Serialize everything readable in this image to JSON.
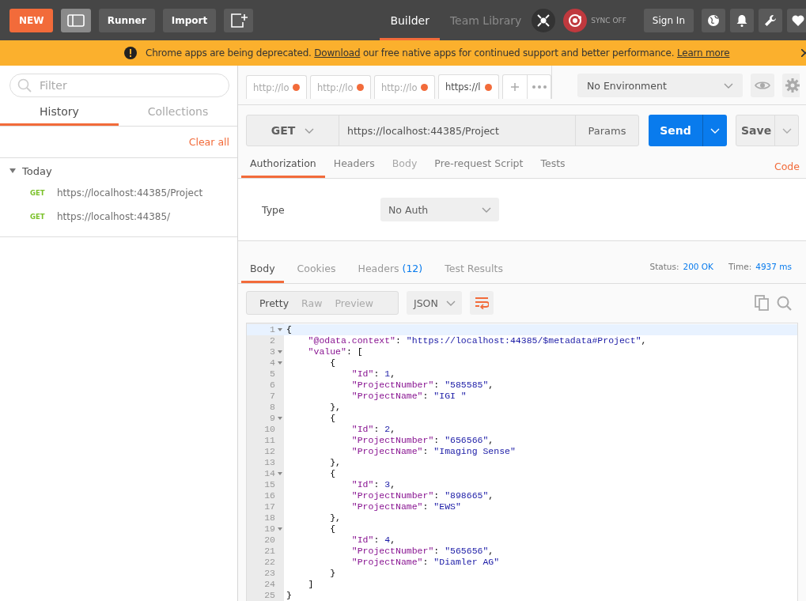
{
  "header": {
    "new_button": "NEW",
    "runner_button": "Runner",
    "import_button": "Import",
    "tabs": [
      {
        "label": "Builder",
        "selected": true
      },
      {
        "label": "Team Library",
        "selected": false
      }
    ],
    "sync": {
      "label": "SYNC OFF",
      "on": false
    },
    "sign_in_button": "Sign In"
  },
  "banner": {
    "text_before": "Chrome apps are being deprecated.",
    "link": "Download",
    "text_after": "our free native apps for continued support and better performance.",
    "learn_more": "Learn more"
  },
  "sidebar": {
    "filter": {
      "placeholder": "Filter"
    },
    "tabs": [
      {
        "label": "History",
        "selected": true
      },
      {
        "label": "Collections",
        "selected": false
      }
    ],
    "clear_all": "Clear all",
    "groups": [
      {
        "label": "Today",
        "expanded": true,
        "items": [
          {
            "method": "GET",
            "url": "https://localhost:44385/Project"
          },
          {
            "method": "GET",
            "url": "https://localhost:44385/"
          }
        ]
      }
    ]
  },
  "request_tabs": [
    {
      "label": "http://lo",
      "unsaved": true,
      "selected": false
    },
    {
      "label": "http://lo",
      "unsaved": true,
      "selected": false
    },
    {
      "label": "http://lo",
      "unsaved": true,
      "selected": false
    },
    {
      "label": "https://l",
      "unsaved": true,
      "selected": true
    }
  ],
  "environment": {
    "label": "No Environment"
  },
  "request": {
    "method": "GET",
    "url": "https://localhost:44385/Project",
    "params_button": "Params",
    "send_button": "Send",
    "save_button": "Save"
  },
  "request_sections": [
    {
      "label": "Authorization",
      "selected": true,
      "disabled": false
    },
    {
      "label": "Headers",
      "selected": false,
      "disabled": false
    },
    {
      "label": "Body",
      "selected": false,
      "disabled": true
    },
    {
      "label": "Pre-request Script",
      "selected": false,
      "disabled": false
    },
    {
      "label": "Tests",
      "selected": false,
      "disabled": false
    }
  ],
  "code_link": "Code",
  "auth": {
    "type_label": "Type",
    "type_value": "No Auth"
  },
  "response": {
    "tabs": [
      {
        "label": "Body",
        "selected": true
      },
      {
        "label": "Cookies",
        "selected": false
      },
      {
        "label": "Headers",
        "count": "(12)",
        "selected": false
      },
      {
        "label": "Test Results",
        "selected": false
      }
    ],
    "status_label": "Status:",
    "status_value": "200 OK",
    "time_label": "Time:",
    "time_value": "4937 ms",
    "view_modes": [
      {
        "label": "Pretty",
        "selected": true
      },
      {
        "label": "Raw",
        "selected": false
      },
      {
        "label": "Preview",
        "selected": false
      }
    ],
    "format": "JSON",
    "wrap_on": true,
    "lines": [
      {
        "number": "1",
        "active": true,
        "tokens": [
          {
            "kind": "punct",
            "text": "{"
          }
        ],
        "children": [
          {
            "number": "2",
            "active": false,
            "tokens": [
              {
                "kind": "key",
                "text": "\"@odata.context\""
              },
              {
                "kind": "punct",
                "text": ": "
              },
              {
                "kind": "string",
                "text": "\"https://localhost:44385/$metadata#Project\""
              },
              {
                "kind": "punct",
                "text": ","
              }
            ]
          },
          {
            "number": "3",
            "active": false,
            "tokens": [
              {
                "kind": "key",
                "text": "\"value\""
              },
              {
                "kind": "punct",
                "text": ": ["
              }
            ],
            "children": [
              {
                "number": "4",
                "active": false,
                "tokens": [
                  {
                    "kind": "punct",
                    "text": "{"
                  }
                ],
                "children": [
                  {
                    "number": "5",
                    "active": false,
                    "tokens": [
                      {
                        "kind": "key",
                        "text": "\"Id\""
                      },
                      {
                        "kind": "punct",
                        "text": ": "
                      },
                      {
                        "kind": "number",
                        "text": "1"
                      },
                      {
                        "kind": "punct",
                        "text": ","
                      }
                    ]
                  },
                  {
                    "number": "6",
                    "active": false,
                    "tokens": [
                      {
                        "kind": "key",
                        "text": "\"ProjectNumber\""
                      },
                      {
                        "kind": "punct",
                        "text": ": "
                      },
                      {
                        "kind": "string",
                        "text": "\"585585\""
                      },
                      {
                        "kind": "punct",
                        "text": ","
                      }
                    ]
                  },
                  {
                    "number": "7",
                    "active": false,
                    "tokens": [
                      {
                        "kind": "key",
                        "text": "\"ProjectName\""
                      },
                      {
                        "kind": "punct",
                        "text": ": "
                      },
                      {
                        "kind": "string",
                        "text": "\"IGI \""
                      }
                    ]
                  }
                ]
              },
              {
                "number": "8",
                "active": false,
                "tokens": [
                  {
                    "kind": "punct",
                    "text": "},"
                  }
                ]
              },
              {
                "number": "9",
                "active": false,
                "tokens": [
                  {
                    "kind": "punct",
                    "text": "{"
                  }
                ],
                "children": [
                  {
                    "number": "10",
                    "active": false,
                    "tokens": [
                      {
                        "kind": "key",
                        "text": "\"Id\""
                      },
                      {
                        "kind": "punct",
                        "text": ": "
                      },
                      {
                        "kind": "number",
                        "text": "2"
                      },
                      {
                        "kind": "punct",
                        "text": ","
                      }
                    ]
                  },
                  {
                    "number": "11",
                    "active": false,
                    "tokens": [
                      {
                        "kind": "key",
                        "text": "\"ProjectNumber\""
                      },
                      {
                        "kind": "punct",
                        "text": ": "
                      },
                      {
                        "kind": "string",
                        "text": "\"656566\""
                      },
                      {
                        "kind": "punct",
                        "text": ","
                      }
                    ]
                  },
                  {
                    "number": "12",
                    "active": false,
                    "tokens": [
                      {
                        "kind": "key",
                        "text": "\"ProjectName\""
                      },
                      {
                        "kind": "punct",
                        "text": ": "
                      },
                      {
                        "kind": "string",
                        "text": "\"Imaging Sense\""
                      }
                    ]
                  }
                ]
              },
              {
                "number": "13",
                "active": false,
                "tokens": [
                  {
                    "kind": "punct",
                    "text": "},"
                  }
                ]
              },
              {
                "number": "14",
                "active": false,
                "tokens": [
                  {
                    "kind": "punct",
                    "text": "{"
                  }
                ],
                "children": [
                  {
                    "number": "15",
                    "active": false,
                    "tokens": [
                      {
                        "kind": "key",
                        "text": "\"Id\""
                      },
                      {
                        "kind": "punct",
                        "text": ": "
                      },
                      {
                        "kind": "number",
                        "text": "3"
                      },
                      {
                        "kind": "punct",
                        "text": ","
                      }
                    ]
                  },
                  {
                    "number": "16",
                    "active": false,
                    "tokens": [
                      {
                        "kind": "key",
                        "text": "\"ProjectNumber\""
                      },
                      {
                        "kind": "punct",
                        "text": ": "
                      },
                      {
                        "kind": "string",
                        "text": "\"898665\""
                      },
                      {
                        "kind": "punct",
                        "text": ","
                      }
                    ]
                  },
                  {
                    "number": "17",
                    "active": false,
                    "tokens": [
                      {
                        "kind": "key",
                        "text": "\"ProjectName\""
                      },
                      {
                        "kind": "punct",
                        "text": ": "
                      },
                      {
                        "kind": "string",
                        "text": "\"EWS\""
                      }
                    ]
                  }
                ]
              },
              {
                "number": "18",
                "active": false,
                "tokens": [
                  {
                    "kind": "punct",
                    "text": "},"
                  }
                ]
              },
              {
                "number": "19",
                "active": false,
                "tokens": [
                  {
                    "kind": "punct",
                    "text": "{"
                  }
                ],
                "children": [
                  {
                    "number": "20",
                    "active": false,
                    "tokens": [
                      {
                        "kind": "key",
                        "text": "\"Id\""
                      },
                      {
                        "kind": "punct",
                        "text": ": "
                      },
                      {
                        "kind": "number",
                        "text": "4"
                      },
                      {
                        "kind": "punct",
                        "text": ","
                      }
                    ]
                  },
                  {
                    "number": "21",
                    "active": false,
                    "tokens": [
                      {
                        "kind": "key",
                        "text": "\"ProjectNumber\""
                      },
                      {
                        "kind": "punct",
                        "text": ": "
                      },
                      {
                        "kind": "string",
                        "text": "\"565656\""
                      },
                      {
                        "kind": "punct",
                        "text": ","
                      }
                    ]
                  },
                  {
                    "number": "22",
                    "active": false,
                    "tokens": [
                      {
                        "kind": "key",
                        "text": "\"ProjectName\""
                      },
                      {
                        "kind": "punct",
                        "text": ": "
                      },
                      {
                        "kind": "string",
                        "text": "\"Diamler AG\""
                      }
                    ]
                  }
                ]
              },
              {
                "number": "23",
                "active": false,
                "tokens": [
                  {
                    "kind": "punct",
                    "text": "}"
                  }
                ]
              }
            ]
          },
          {
            "number": "24",
            "active": false,
            "tokens": [
              {
                "kind": "punct",
                "text": "]"
              }
            ]
          }
        ]
      },
      {
        "number": "25",
        "active": false,
        "tokens": [
          {
            "kind": "punct",
            "text": "}"
          }
        ]
      }
    ]
  }
}
